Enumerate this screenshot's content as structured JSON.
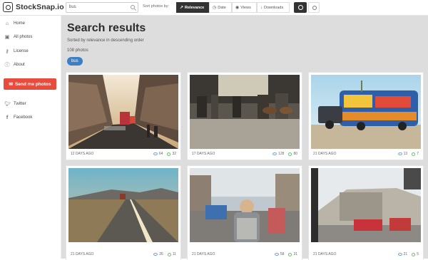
{
  "app": {
    "name": "StockSnap.io"
  },
  "search": {
    "value": "bus"
  },
  "sort": {
    "label": "Sort photos by:",
    "options": [
      {
        "label": "Relevance",
        "icon": "trending-icon",
        "active": true
      },
      {
        "label": "Date",
        "icon": "clock-icon",
        "active": false
      },
      {
        "label": "Views",
        "icon": "eye-icon",
        "active": false
      },
      {
        "label": "Downloads",
        "icon": "download-icon",
        "active": false
      }
    ]
  },
  "sidebar": {
    "items": [
      {
        "label": "Home",
        "icon": "home-icon"
      },
      {
        "label": "All photos",
        "icon": "photos-icon"
      },
      {
        "label": "License",
        "icon": "key-icon"
      },
      {
        "label": "About",
        "icon": "info-icon"
      }
    ],
    "send_label": "Send me photos",
    "social": [
      {
        "label": "Twitter",
        "icon": "twitter-icon"
      },
      {
        "label": "Facebook",
        "icon": "facebook-icon"
      }
    ]
  },
  "results": {
    "title": "Search results",
    "subtitle": "Sorted by relevance in descending order",
    "count": "108 photos",
    "tag": "bus"
  },
  "photos": [
    {
      "age": "12 DAYS AGO",
      "views": "64",
      "downloads": "32"
    },
    {
      "age": "17 DAYS AGO",
      "views": "128",
      "downloads": "80"
    },
    {
      "age": "21 DAYS AGO",
      "views": "13",
      "downloads": "7"
    },
    {
      "age": "21 DAYS AGO",
      "views": "26",
      "downloads": "11"
    },
    {
      "age": "21 DAYS AGO",
      "views": "58",
      "downloads": "31"
    },
    {
      "age": "21 DAYS AGO",
      "views": "21",
      "downloads": "5"
    }
  ],
  "colors": {
    "accent": "#3d7fc4",
    "send": "#e74c3c",
    "dark": "#333333"
  }
}
